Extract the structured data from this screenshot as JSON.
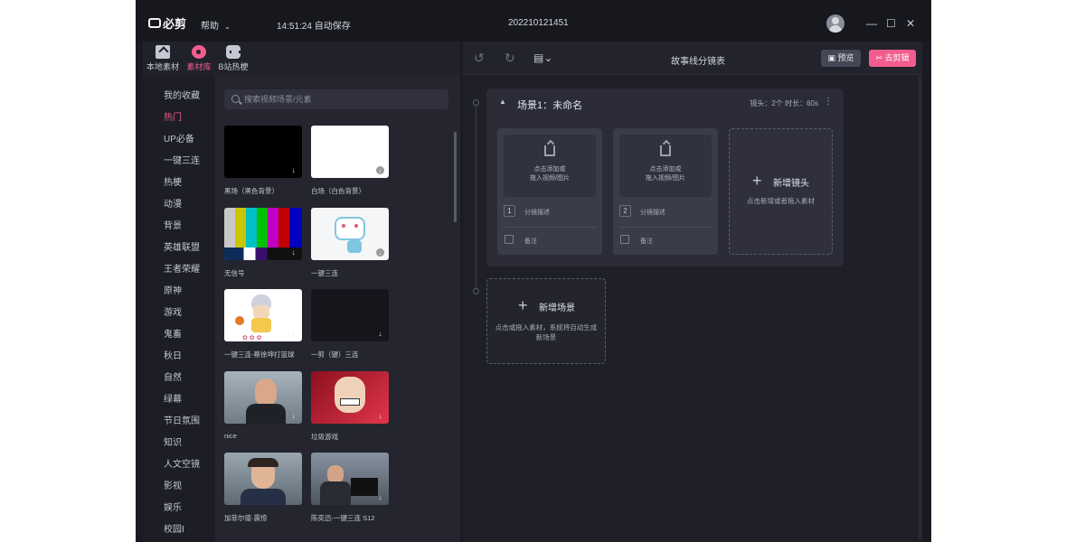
{
  "app": {
    "logo_text": "必剪",
    "help_label": "帮助",
    "autosave_text": "14:51:24 自动保存",
    "project_title": "202210121451",
    "window_controls": {
      "minimize": "—",
      "maximize": "☐",
      "close": "✕"
    }
  },
  "left": {
    "tabs": [
      {
        "label": "本地素材",
        "icon": "folder-upload-icon",
        "active": false
      },
      {
        "label": "素材库",
        "icon": "film-reel-icon",
        "active": true
      },
      {
        "label": "B站热梗",
        "icon": "bilibili-tv-icon",
        "active": false
      }
    ],
    "categories": [
      "我的收藏",
      "热门",
      "UP必备",
      "一键三连",
      "热梗",
      "动漫",
      "背景",
      "英雄联盟",
      "王者荣耀",
      "原神",
      "游戏",
      "鬼畜",
      "秋日",
      "自然",
      "绿幕",
      "节日氛围",
      "知识",
      "人文空镜",
      "影视",
      "娱乐",
      "校园I"
    ],
    "active_category": "热门",
    "search_placeholder": "搜索视频场景/元素",
    "materials": [
      {
        "label": "黑场（黑色背景）"
      },
      {
        "label": "白场（白色背景）"
      },
      {
        "label": "无信号"
      },
      {
        "label": "一键三连"
      },
      {
        "label": "一键三连-蔡徐坤打篮球"
      },
      {
        "label": "一剪（键）三连"
      },
      {
        "label": "nice"
      },
      {
        "label": "垃圾游戏"
      },
      {
        "label": "加菲尔德·震惊"
      },
      {
        "label": "陈奕迅-一键三连 S12"
      }
    ]
  },
  "right": {
    "undo_icon": "undo-icon",
    "redo_icon": "redo-icon",
    "layout_icon": "layout-toggle-icon",
    "board_title": "故事线分镜表",
    "preview_label": "预览",
    "edit_label": "去剪辑",
    "scene": {
      "title": "场景1：未命名",
      "meta": "镜头：2个   时长：60s",
      "shots": [
        {
          "index": "1",
          "drop_line1": "点击添加或",
          "drop_line2": "拖入视频/图片",
          "desc": "分镜描述",
          "note": "备注"
        },
        {
          "index": "2",
          "drop_line1": "点击添加或",
          "drop_line2": "拖入视频/图片",
          "desc": "分镜描述",
          "note": "备注"
        }
      ],
      "add_shot_label": "新增镜头",
      "add_shot_sub": "点击新增或者拖入素材"
    },
    "add_scene": {
      "label": "新增场景",
      "sub": "点击或拖入素材，系统将自动生成新场景"
    }
  },
  "colors": {
    "accent": "#f25d8e",
    "background": "#1a1b22",
    "panel": "#24252f",
    "card": "#2b2c37"
  }
}
